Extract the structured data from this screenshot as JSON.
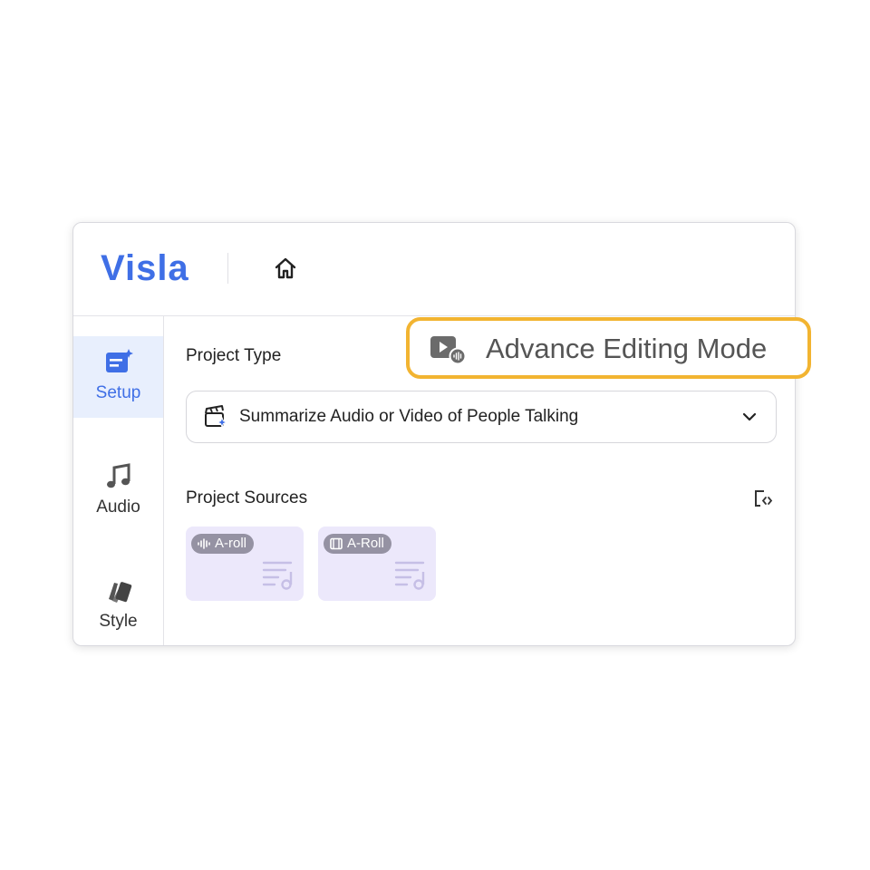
{
  "app": {
    "logo": "Visla"
  },
  "sidebar": {
    "items": [
      {
        "label": "Setup",
        "icon": "setup-icon",
        "active": true
      },
      {
        "label": "Audio",
        "icon": "music-note-icon",
        "active": false
      },
      {
        "label": "Style",
        "icon": "style-swatch-icon",
        "active": false
      }
    ]
  },
  "main": {
    "project_type_label": "Project Type",
    "project_type_value": "Summarize Audio or Video of People Talking",
    "project_sources_label": "Project Sources",
    "sources": [
      {
        "badge": "A-roll",
        "badge_icon": "audio-wave-icon"
      },
      {
        "badge": "A-Roll",
        "badge_icon": "film-icon"
      }
    ]
  },
  "callout": {
    "label": "Advance Editing Mode",
    "icon": "video-audio-icon"
  },
  "colors": {
    "accent": "#3f6fe6",
    "highlight": "#f2b431",
    "card": "#ece8fb",
    "active_bg": "#e8effd"
  }
}
